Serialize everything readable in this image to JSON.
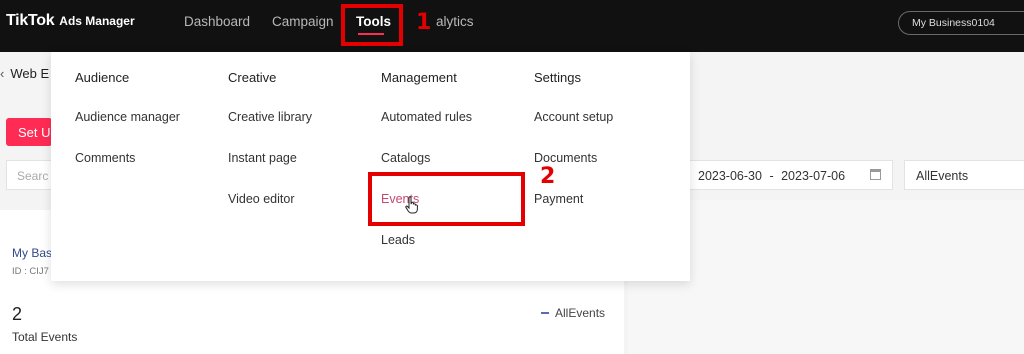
{
  "topbar": {
    "logo": "TikTok",
    "logo_sub": "Ads Manager",
    "nav": [
      "Dashboard",
      "Campaign",
      "Tools",
      "Analytics"
    ],
    "nav_partial_visible": "alytics",
    "business_button": "My Business0104"
  },
  "page": {
    "back_title": "Web E",
    "setup_button": "Set U",
    "search_placeholder": "Searc",
    "date_start": "2023-06-30",
    "date_sep": "-",
    "date_end": "2023-07-06",
    "event_select": "AllEvents",
    "business_name": "My Bas",
    "business_id": "ID : CIJ7",
    "total_events_value": "2",
    "total_events_label": "Total Events",
    "legend_label": "AllEvents"
  },
  "menu": {
    "columns": [
      {
        "heading": "Audience",
        "items": [
          "Audience manager",
          "Comments"
        ]
      },
      {
        "heading": "Creative",
        "items": [
          "Creative library",
          "Instant page",
          "Video editor"
        ]
      },
      {
        "heading": "Management",
        "items": [
          "Automated rules",
          "Catalogs",
          "Events",
          "Leads"
        ]
      },
      {
        "heading": "Settings",
        "items": [
          "Account setup",
          "Documents",
          "Payment"
        ]
      }
    ]
  },
  "annotations": {
    "step1": "1",
    "step2": "2"
  },
  "colors": {
    "accent": "#fe2c55",
    "annotation": "#e40000",
    "topbar": "#111111"
  }
}
